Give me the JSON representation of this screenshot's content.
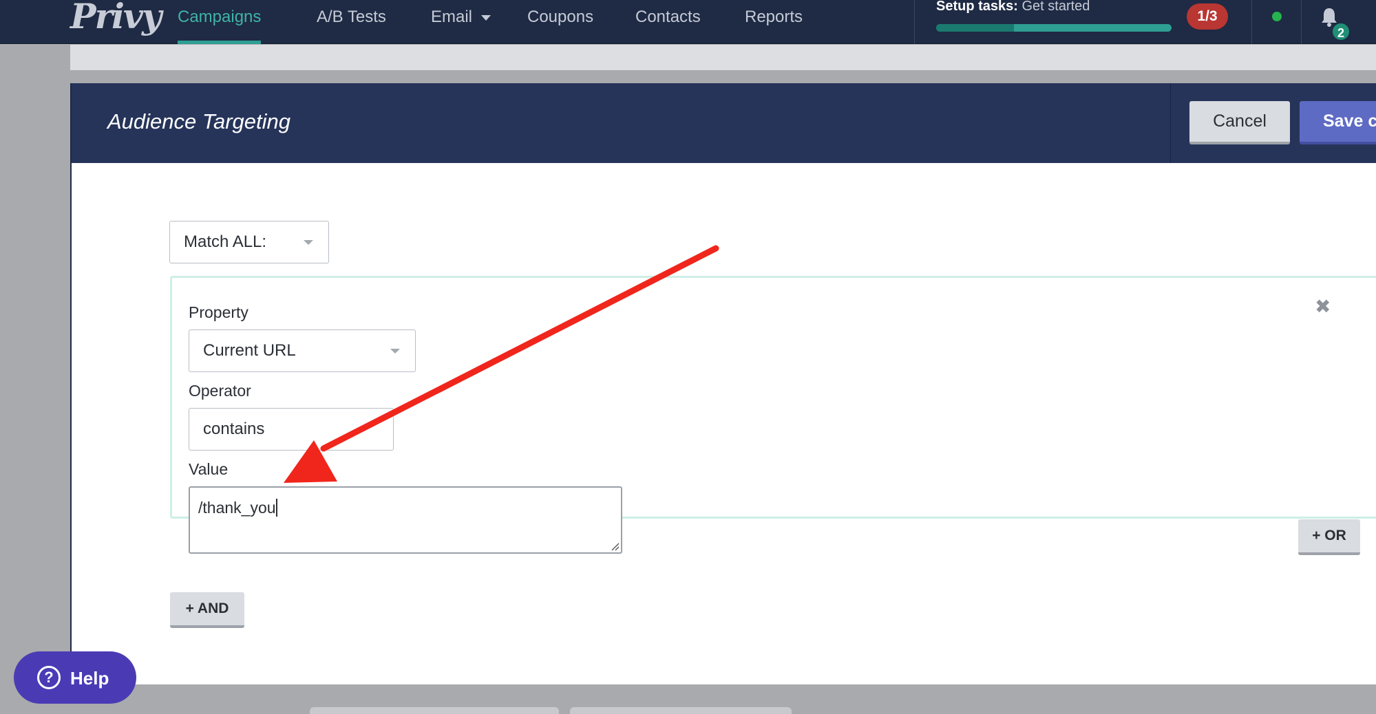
{
  "nav": {
    "logo": "Privy",
    "items": [
      {
        "label": "Campaigns"
      },
      {
        "label": "A/B Tests"
      },
      {
        "label": "Email"
      },
      {
        "label": "Coupons"
      },
      {
        "label": "Contacts"
      },
      {
        "label": "Reports"
      }
    ],
    "active_index": 0,
    "setup": {
      "label_bold": "Setup tasks:",
      "label_rest": " Get started",
      "progress": 0.33,
      "badge": "1/3"
    },
    "notifications": {
      "count": "2"
    }
  },
  "modal": {
    "title": "Audience Targeting",
    "cancel_label": "Cancel",
    "save_label": "Save changes",
    "match_select": {
      "value": "Match ALL:"
    },
    "rule": {
      "property_label": "Property",
      "property_value": "Current URL",
      "operator_label": "Operator",
      "operator_value": "contains",
      "value_label": "Value",
      "value_text": "/thank_you"
    },
    "or_label": "+ OR",
    "and_label": "+ AND"
  },
  "help": {
    "label": "Help",
    "icon": "?"
  },
  "colors": {
    "nav_bg": "#1f2a44",
    "accent": "#3fb3a6",
    "modal_header": "#26345a",
    "save_button": "#5e6bc4",
    "badge_red": "#b93632",
    "help_button": "#4a3bb5",
    "arrow": "#f0261c"
  }
}
